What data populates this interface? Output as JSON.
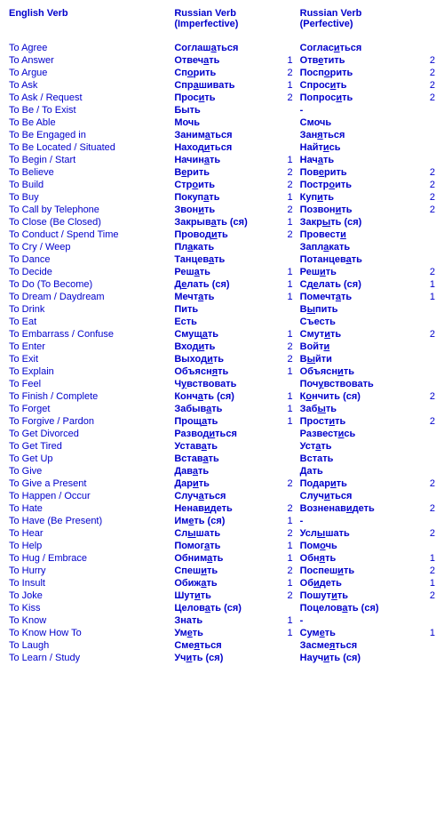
{
  "headers": {
    "english": "English Verb",
    "imperfective": "Russian Verb\n(Imperfective)",
    "perfective": "Russian Verb\n(Perfective)"
  },
  "rows": [
    {
      "en": "To Agree",
      "imp": "Соглаш<u>а</u>ться",
      "n1": "",
      "pf": "Соглас<u>и</u>ться",
      "n2": ""
    },
    {
      "en": "To Answer",
      "imp": "Отвеч<u>а</u>ть",
      "n1": "1",
      "pf": "Отв<u>е</u>тить",
      "n2": "2"
    },
    {
      "en": "To Argue",
      "imp": "Сп<u>о</u>рить",
      "n1": "2",
      "pf": "Посп<u>о</u>рить",
      "n2": "2"
    },
    {
      "en": "To Ask",
      "imp": "Спр<u>а</u>шивать",
      "n1": "1",
      "pf": "Спрос<u>и</u>ть",
      "n2": "2"
    },
    {
      "en": "To Ask / Request",
      "imp": "Прос<u>и</u>ть",
      "n1": "2",
      "pf": "Попрос<u>и</u>ть",
      "n2": "2"
    },
    {
      "en": "To Be / To Exist",
      "imp": "Быть",
      "n1": "",
      "pf": "-",
      "n2": ""
    },
    {
      "en": "To Be Able",
      "imp": "Мочь",
      "n1": "",
      "pf": "Смочь",
      "n2": ""
    },
    {
      "en": "To Be Engaged in",
      "imp": "Заним<u>а</u>ться",
      "n1": "",
      "pf": "Зан<u>я</u>ться",
      "n2": ""
    },
    {
      "en": "To Be Located / Situated",
      "imp": "Наход<u>и</u>ться",
      "n1": "",
      "pf": "Найт<u>и</u>сь",
      "n2": ""
    },
    {
      "en": "To Begin / Start",
      "imp": "Начин<u>а</u>ть",
      "n1": "1",
      "pf": "Нач<u>а</u>ть",
      "n2": ""
    },
    {
      "en": "To Believe",
      "imp": "В<u>е</u>рить",
      "n1": "2",
      "pf": "Пов<u>е</u>рить",
      "n2": "2"
    },
    {
      "en": "To Build",
      "imp": "Стр<u>о</u>ить",
      "n1": "2",
      "pf": "Постр<u>о</u>ить",
      "n2": "2"
    },
    {
      "en": "To Buy",
      "imp": "Покуп<u>а</u>ть",
      "n1": "1",
      "pf": "Куп<u>и</u>ть",
      "n2": "2"
    },
    {
      "en": "To Call by Telephone",
      "imp": "Звон<u>и</u>ть",
      "n1": "2",
      "pf": "Позвон<u>и</u>ть",
      "n2": "2"
    },
    {
      "en": "To Close (Be Closed)",
      "imp": "Закрыв<u>а</u>ть (ся)",
      "n1": "1",
      "pf": "Закр<u>ы</u>ть (ся)",
      "n2": ""
    },
    {
      "en": "To Conduct / Spend Time",
      "imp": "Провод<u>и</u>ть",
      "n1": "2",
      "pf": "Провест<u>и</u>",
      "n2": ""
    },
    {
      "en": "To Cry / Weep",
      "imp": "Пл<u>а</u>кать",
      "n1": "",
      "pf": "Запл<u>а</u>кать",
      "n2": ""
    },
    {
      "en": "To Dance",
      "imp": "Танцев<u>а</u>ть",
      "n1": "",
      "pf": "Потанцев<u>а</u>ть",
      "n2": ""
    },
    {
      "en": "To Decide",
      "imp": "Реш<u>а</u>ть",
      "n1": "1",
      "pf": "Реш<u>и</u>ть",
      "n2": "2"
    },
    {
      "en": "To Do (To Become)",
      "imp": "Д<u>е</u>лать (ся)",
      "n1": "1",
      "pf": "Сд<u>е</u>лать (ся)",
      "n2": "1"
    },
    {
      "en": "To Dream / Daydream",
      "imp": "Мечт<u>а</u>ть",
      "n1": "1",
      "pf": "Помечт<u>а</u>ть",
      "n2": "1"
    },
    {
      "en": "To Drink",
      "imp": "Пить",
      "n1": "",
      "pf": "В<u>ы</u>пить",
      "n2": ""
    },
    {
      "en": "To Eat",
      "imp": "Есть",
      "n1": "",
      "pf": "Съесть",
      "n2": ""
    },
    {
      "en": "To Embarrass / Confuse",
      "imp": "Смущ<u>а</u>ть",
      "n1": "1",
      "pf": "Смут<u>и</u>ть",
      "n2": "2"
    },
    {
      "en": "To Enter",
      "imp": "Вход<u>и</u>ть",
      "n1": "2",
      "pf": "Войт<u>и</u>",
      "n2": ""
    },
    {
      "en": "To Exit",
      "imp": "Выход<u>и</u>ть",
      "n1": "2",
      "pf": "В<u>ы</u>йти",
      "n2": ""
    },
    {
      "en": "To Explain",
      "imp": "Объясн<u>я</u>ть",
      "n1": "1",
      "pf": "Объясн<u>и</u>ть",
      "n2": ""
    },
    {
      "en": "To Feel",
      "imp": "Ч<u>у</u>вствовать",
      "n1": "",
      "pf": "Поч<u>у</u>вствовать",
      "n2": ""
    },
    {
      "en": "To Finish / Complete",
      "imp": "Конч<u>а</u>ть (ся)",
      "n1": "1",
      "pf": "К<u>о</u>нчить (ся)",
      "n2": "2"
    },
    {
      "en": "To Forget",
      "imp": "Забыв<u>а</u>ть",
      "n1": "1",
      "pf": "Заб<u>ы</u>ть",
      "n2": ""
    },
    {
      "en": "To Forgive / Pardon",
      "imp": "Прощ<u>а</u>ть",
      "n1": "1",
      "pf": "Прост<u>и</u>ть",
      "n2": "2"
    },
    {
      "en": "To Get Divorced",
      "imp": "Развод<u>и</u>ться",
      "n1": "",
      "pf": "Развест<u>и</u>сь",
      "n2": ""
    },
    {
      "en": "To Get Tired",
      "imp": "Устав<u>а</u>ть",
      "n1": "",
      "pf": "Уст<u>а</u>ть",
      "n2": ""
    },
    {
      "en": "To Get Up",
      "imp": "Встав<u>а</u>ть",
      "n1": "",
      "pf": "Встать",
      "n2": ""
    },
    {
      "en": "To Give",
      "imp": "Дав<u>а</u>ть",
      "n1": "",
      "pf": "Дать",
      "n2": ""
    },
    {
      "en": "To Give a Present",
      "imp": "Дар<u>и</u>ть",
      "n1": "2",
      "pf": "Подар<u>и</u>ть",
      "n2": "2"
    },
    {
      "en": "To Happen / Occur",
      "imp": "Случ<u>а</u>ться",
      "n1": "",
      "pf": "Случ<u>и</u>ться",
      "n2": ""
    },
    {
      "en": "To Hate",
      "imp": "Ненав<u>и</u>деть",
      "n1": "2",
      "pf": "Возненав<u>и</u>деть",
      "n2": "2"
    },
    {
      "en": "To Have (Be Present)",
      "imp": "Им<u>е</u>ть (ся)",
      "n1": "1",
      "pf": "-",
      "n2": ""
    },
    {
      "en": "To Hear",
      "imp": "Сл<u>ы</u>шать",
      "n1": "2",
      "pf": "Усл<u>ы</u>шать",
      "n2": "2"
    },
    {
      "en": "To Help",
      "imp": "Помог<u>а</u>ть",
      "n1": "1",
      "pf": "Пом<u>о</u>чь",
      "n2": ""
    },
    {
      "en": "To Hug / Embrace",
      "imp": "Обним<u>а</u>ть",
      "n1": "1",
      "pf": "Обн<u>я</u>ть",
      "n2": "1"
    },
    {
      "en": "To Hurry",
      "imp": "Спеш<u>и</u>ть",
      "n1": "2",
      "pf": "Поспеш<u>и</u>ть",
      "n2": "2"
    },
    {
      "en": "To Insult",
      "imp": "Обиж<u>а</u>ть",
      "n1": "1",
      "pf": "Об<u>и</u>деть",
      "n2": "1"
    },
    {
      "en": "To Joke",
      "imp": "Шут<u>и</u>ть",
      "n1": "2",
      "pf": "Пошут<u>и</u>ть",
      "n2": "2"
    },
    {
      "en": "To Kiss",
      "imp": "Целов<u>а</u>ть (ся)",
      "n1": "",
      "pf": "Поцелов<u>а</u>ть (ся)",
      "n2": ""
    },
    {
      "en": "To Know",
      "imp": "Знать",
      "n1": "1",
      "pf": "-",
      "n2": ""
    },
    {
      "en": "To Know How To",
      "imp": "Ум<u>е</u>ть",
      "n1": "1",
      "pf": "Сум<u>е</u>ть",
      "n2": "1"
    },
    {
      "en": "To Laugh",
      "imp": "Сме<u>я</u>ться",
      "n1": "",
      "pf": "Засме<u>я</u>ться",
      "n2": ""
    },
    {
      "en": "To Learn / Study",
      "imp": "Уч<u>и</u>ть (ся)",
      "n1": "",
      "pf": "Науч<u>и</u>ть (ся)",
      "n2": ""
    }
  ]
}
